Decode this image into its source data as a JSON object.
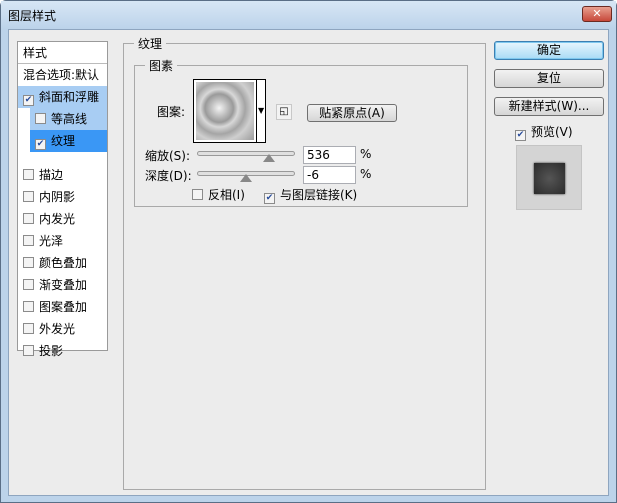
{
  "title": "图层样式",
  "sidebar": {
    "header": "样式",
    "blend": "混合选项:默认",
    "items": [
      {
        "label": "斜面和浮雕",
        "checked": true
      },
      {
        "label": "等高线",
        "checked": false
      },
      {
        "label": "纹理",
        "checked": true
      },
      {
        "label": "描边",
        "checked": false
      },
      {
        "label": "内阴影",
        "checked": false
      },
      {
        "label": "内发光",
        "checked": false
      },
      {
        "label": "光泽",
        "checked": false
      },
      {
        "label": "颜色叠加",
        "checked": false
      },
      {
        "label": "渐变叠加",
        "checked": false
      },
      {
        "label": "图案叠加",
        "checked": false
      },
      {
        "label": "外发光",
        "checked": false
      },
      {
        "label": "投影",
        "checked": false
      }
    ]
  },
  "panel": {
    "title": "纹理",
    "group": "图素",
    "pattern_label": "图案:",
    "snap_button": "贴紧原点(A)",
    "scale_label": "缩放(S):",
    "scale_value": "536",
    "scale_pct": 53.6,
    "depth_label": "深度(D):",
    "depth_value": "-6",
    "depth_pct": -6,
    "percent": "%",
    "invert_label": "反相(I)",
    "invert_checked": false,
    "link_label": "与图层链接(K)",
    "link_checked": true
  },
  "buttons": {
    "ok": "确定",
    "reset": "复位",
    "new_style": "新建样式(W)...",
    "preview": "预览(V)",
    "preview_checked": true
  },
  "close": "✕"
}
